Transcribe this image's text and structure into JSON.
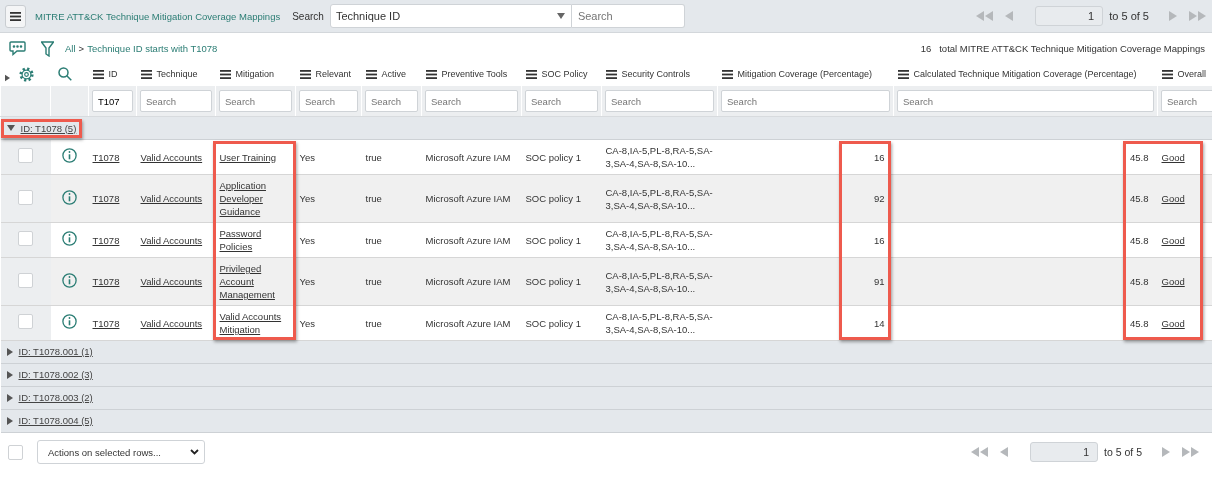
{
  "header": {
    "title": "MITRE ATT&CK Technique Mitigation Coverage Mappings",
    "search_label": "Search",
    "search_column": "Technique ID",
    "search_placeholder": "Search"
  },
  "pager_top": {
    "page": "1",
    "range": "to 5 of 5"
  },
  "breadcrumb": {
    "root": "All",
    "separator": ">",
    "filter": "Technique ID starts with T1078"
  },
  "total": {
    "count": "16",
    "label": "total MITRE ATT&CK Technique Mitigation Coverage Mappings"
  },
  "columns": [
    {
      "label": "ID",
      "kind": "link",
      "filter_value": "T107"
    },
    {
      "label": "Technique",
      "kind": "link",
      "filter_placeholder": "Search"
    },
    {
      "label": "Mitigation",
      "kind": "link",
      "filter_placeholder": "Search",
      "highlighted": true
    },
    {
      "label": "Relevant",
      "kind": "text",
      "filter_placeholder": "Search"
    },
    {
      "label": "Active",
      "kind": "text",
      "filter_placeholder": "Search"
    },
    {
      "label": "Preventive Tools",
      "kind": "text",
      "filter_placeholder": "Search"
    },
    {
      "label": "SOC Policy",
      "kind": "text",
      "filter_placeholder": "Search"
    },
    {
      "label": "Security Controls",
      "kind": "text",
      "filter_placeholder": "Search"
    },
    {
      "label": "Mitigation Coverage (Percentage)",
      "kind": "number",
      "filter_placeholder": "Search",
      "highlighted": true
    },
    {
      "label": "Calculated Technique Mitigation Coverage (Percentage)",
      "kind": "number",
      "filter_placeholder": "Search",
      "highlighted": true
    },
    {
      "label": "Overall",
      "kind": "link",
      "filter_placeholder": "Search",
      "highlighted": true,
      "highlight_continues": true
    }
  ],
  "groups": [
    {
      "label": "ID: T1078 (5)",
      "expanded": true,
      "highlighted": true,
      "rows": [
        {
          "checked": false,
          "cells": [
            "T1078",
            "Valid Accounts",
            "User Training",
            "Yes",
            "true",
            "Microsoft Azure IAM",
            "SOC policy 1",
            "CA-8,IA-5,PL-8,RA-5,SA-3,SA-4,SA-8,SA-10...",
            "16",
            "45.8",
            "Good"
          ]
        },
        {
          "checked": false,
          "cells": [
            "T1078",
            "Valid Accounts",
            "Application Developer Guidance",
            "Yes",
            "true",
            "Microsoft Azure IAM",
            "SOC policy 1",
            "CA-8,IA-5,PL-8,RA-5,SA-3,SA-4,SA-8,SA-10...",
            "92",
            "45.8",
            "Good"
          ]
        },
        {
          "checked": false,
          "cells": [
            "T1078",
            "Valid Accounts",
            "Password Policies",
            "Yes",
            "true",
            "Microsoft Azure IAM",
            "SOC policy 1",
            "CA-8,IA-5,PL-8,RA-5,SA-3,SA-4,SA-8,SA-10...",
            "16",
            "45.8",
            "Good"
          ]
        },
        {
          "checked": false,
          "cells": [
            "T1078",
            "Valid Accounts",
            "Privileged Account Management",
            "Yes",
            "true",
            "Microsoft Azure IAM",
            "SOC policy 1",
            "CA-8,IA-5,PL-8,RA-5,SA-3,SA-4,SA-8,SA-10...",
            "91",
            "45.8",
            "Good"
          ]
        },
        {
          "checked": false,
          "cells": [
            "T1078",
            "Valid Accounts",
            "Valid Accounts Mitigation",
            "Yes",
            "true",
            "Microsoft Azure IAM",
            "SOC policy 1",
            "CA-8,IA-5,PL-8,RA-5,SA-3,SA-4,SA-8,SA-10...",
            "14",
            "45.8",
            "Good"
          ]
        }
      ]
    },
    {
      "label": "ID: T1078.001 (1)",
      "expanded": false,
      "highlighted": false
    },
    {
      "label": "ID: T1078.002 (3)",
      "expanded": false,
      "highlighted": false
    },
    {
      "label": "ID: T1078.003 (2)",
      "expanded": false,
      "highlighted": false
    },
    {
      "label": "ID: T1078.004 (5)",
      "expanded": false,
      "highlighted": false
    }
  ],
  "footer": {
    "checked": false,
    "actions": "Actions on selected rows..."
  },
  "pager_bottom": {
    "page": "1",
    "range": "to 5 of 5"
  }
}
